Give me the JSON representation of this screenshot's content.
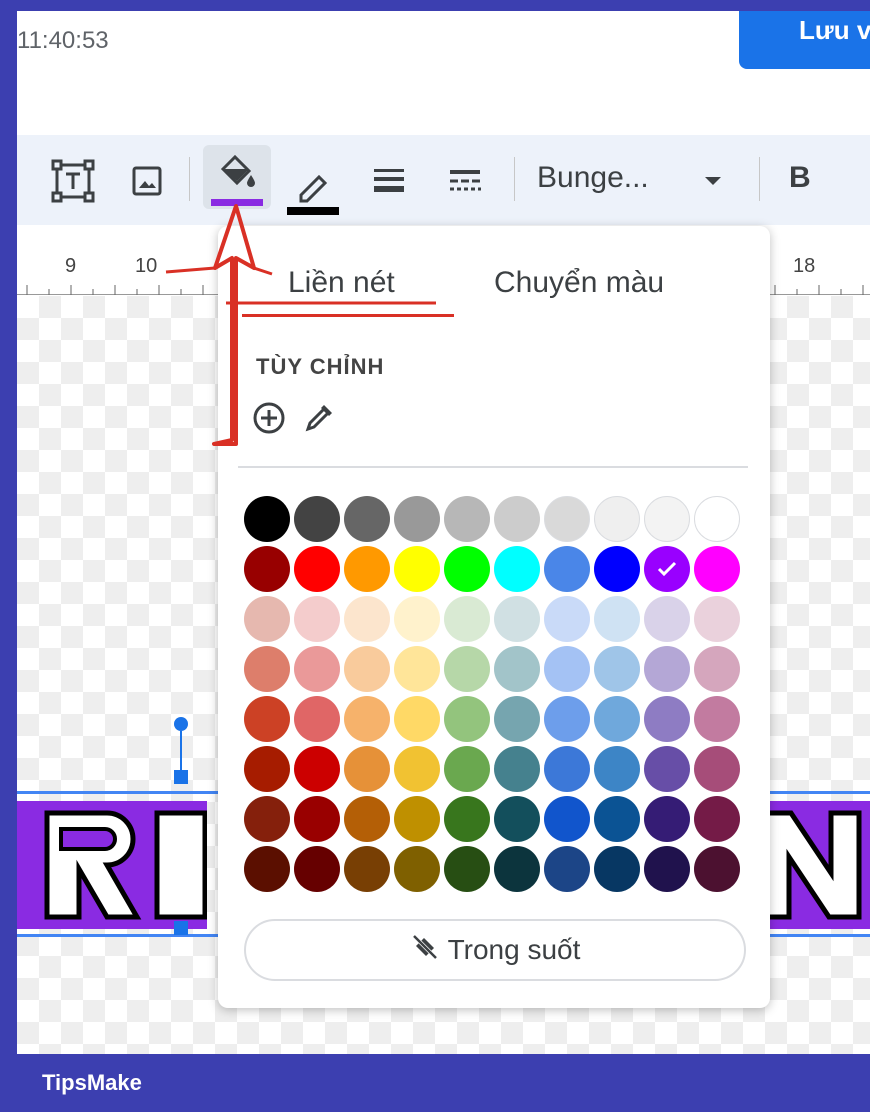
{
  "header": {
    "timestamp": "11:40:53",
    "save_label": "Lưu v"
  },
  "toolbar": {
    "font_name": "Bunge...",
    "bold_label": "B",
    "fill_color": "#8a2be2",
    "border_color": "#000000"
  },
  "ruler": {
    "labels": [
      "9",
      "10",
      "18"
    ]
  },
  "popup": {
    "tabs": [
      "Liền nét",
      "Chuyển màu"
    ],
    "custom_label": "TÙY CHỈNH",
    "transparent_label": "Trong suốt",
    "selected_color": "#9900ff",
    "swatches": [
      [
        "#000000",
        "#434343",
        "#666666",
        "#999999",
        "#b7b7b7",
        "#cccccc",
        "#d9d9d9",
        "#efefef",
        "#f3f3f3",
        "#ffffff"
      ],
      [
        "#980000",
        "#ff0000",
        "#ff9900",
        "#ffff00",
        "#00ff00",
        "#00ffff",
        "#4a86e8",
        "#0000ff",
        "#9900ff",
        "#ff00ff"
      ],
      [
        "#e6b8af",
        "#f4cccc",
        "#fce5cd",
        "#fff2cc",
        "#d9ead3",
        "#d0e0e3",
        "#c9daf8",
        "#cfe2f3",
        "#d9d2e9",
        "#ead1dc"
      ],
      [
        "#dd7e6b",
        "#ea9999",
        "#f9cb9c",
        "#ffe599",
        "#b6d7a8",
        "#a2c4c9",
        "#a4c2f4",
        "#9fc5e8",
        "#b4a7d6",
        "#d5a6bd"
      ],
      [
        "#cc4125",
        "#e06666",
        "#f6b26b",
        "#ffd966",
        "#93c47d",
        "#76a5af",
        "#6d9eeb",
        "#6fa8dc",
        "#8e7cc3",
        "#c27ba0"
      ],
      [
        "#a61c00",
        "#cc0000",
        "#e69138",
        "#f1c232",
        "#6aa84f",
        "#45818e",
        "#3c78d8",
        "#3d85c6",
        "#674ea7",
        "#a64d79"
      ],
      [
        "#85200c",
        "#990000",
        "#b45f06",
        "#bf9000",
        "#38761d",
        "#134f5c",
        "#1155cc",
        "#0b5394",
        "#351c75",
        "#741b47"
      ],
      [
        "#5b0f00",
        "#660000",
        "#783f04",
        "#7f6000",
        "#274e13",
        "#0c343d",
        "#1c4587",
        "#073763",
        "#20124d",
        "#4c1130"
      ]
    ]
  },
  "footer": {
    "brand": "TipsMake"
  },
  "colors": {
    "frame": "#3c3fb0",
    "accent": "#1a73e8",
    "annotation": "#d93025"
  }
}
